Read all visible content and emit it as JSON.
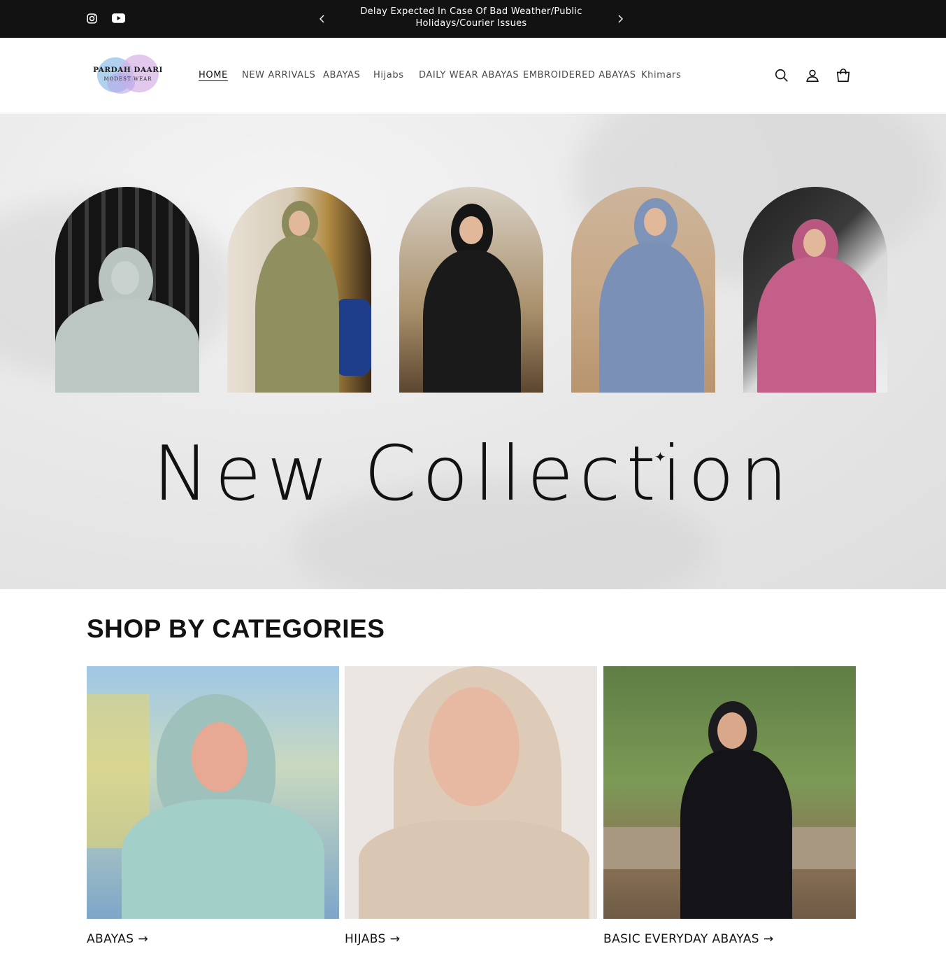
{
  "announcement": {
    "message": "Delay Expected In Case Of Bad Weather/Public Holidays/Courier Issues",
    "social": [
      "instagram-icon",
      "youtube-icon"
    ]
  },
  "header": {
    "logo": {
      "line1": "PARDAH DAARI",
      "line2": "MODEST WEAR"
    },
    "nav": [
      {
        "label": "HOME",
        "active": true
      },
      {
        "label": "NEW ARRIVALS"
      },
      {
        "label": "ABAYAS"
      },
      {
        "label": "Hijabs"
      },
      {
        "label": "DAILY WEAR ABAYAS"
      },
      {
        "label": "EMBROIDERED ABAYAS"
      },
      {
        "label": "Khimars"
      }
    ],
    "icons": [
      "search-icon",
      "account-icon",
      "cart-icon"
    ]
  },
  "hero": {
    "title": "New Collection"
  },
  "categories": {
    "heading": "SHOP BY CATEGORIES",
    "items": [
      {
        "label": "ABAYAS"
      },
      {
        "label": "HIJABS"
      },
      {
        "label": "BASIC EVERYDAY ABAYAS"
      }
    ],
    "arrow": "→"
  },
  "colors": {
    "announcement_bg": "#121212",
    "text": "#121212",
    "hero_bg": "#e9e9e9"
  }
}
